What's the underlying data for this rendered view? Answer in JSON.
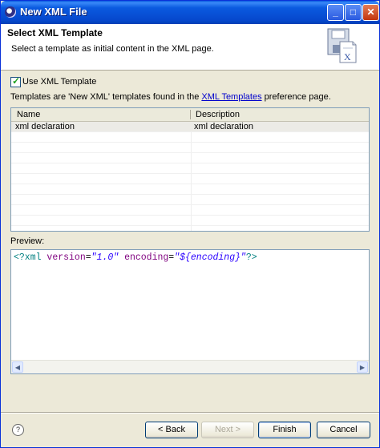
{
  "window": {
    "title": "New XML File"
  },
  "header": {
    "title": "Select XML Template",
    "description": "Select a template as initial content in the XML page."
  },
  "use_template": {
    "label": "Use XML Template",
    "checked": true
  },
  "info": {
    "prefix": "Templates are 'New XML' templates found in the ",
    "link": "XML Templates",
    "suffix": " preference page."
  },
  "table": {
    "columns": [
      "Name",
      "Description"
    ],
    "rows": [
      {
        "name": "xml declaration",
        "description": "xml declaration"
      }
    ]
  },
  "preview": {
    "label": "Preview:",
    "tag_open": "<?xml",
    "attr1": "version",
    "val1": "\"1.0\"",
    "attr2": "encoding",
    "val2": "\"${encoding}\"",
    "tag_close": "?>"
  },
  "buttons": {
    "back": "< Back",
    "next": "Next >",
    "finish": "Finish",
    "cancel": "Cancel"
  },
  "icons": {
    "help": "?",
    "minimize": "_",
    "maximize": "□",
    "close": "✕"
  }
}
